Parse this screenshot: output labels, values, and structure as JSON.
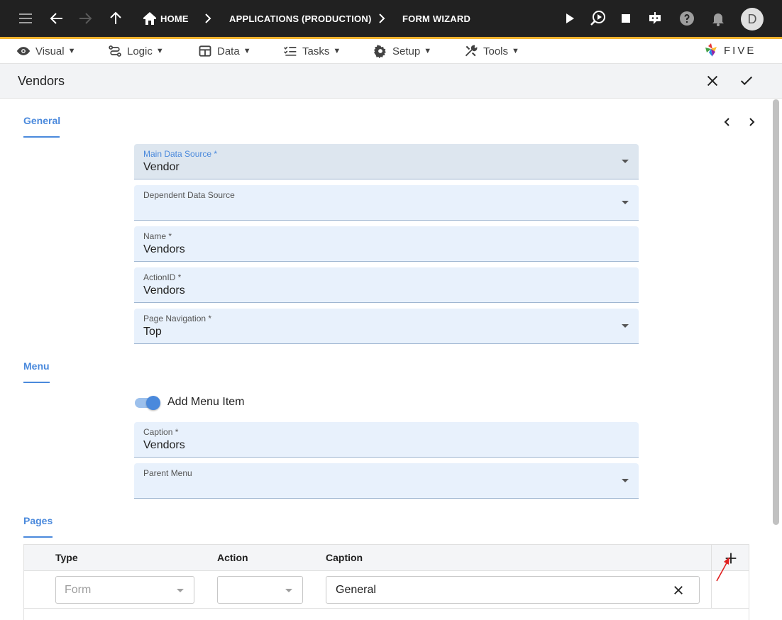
{
  "breadcrumb": {
    "home": "HOME",
    "applications": "APPLICATIONS (PRODUCTION)",
    "current": "FORM WIZARD"
  },
  "user": {
    "avatar_initial": "D"
  },
  "menu": {
    "visual": "Visual",
    "logic": "Logic",
    "data": "Data",
    "tasks": "Tasks",
    "setup": "Setup",
    "tools": "Tools"
  },
  "logo_text": "FIVE",
  "page": {
    "title": "Vendors"
  },
  "sections": {
    "general": "General",
    "menu": "Menu",
    "pages": "Pages"
  },
  "general": {
    "main_data_source": {
      "label": "Main Data Source *",
      "value": "Vendor"
    },
    "dependent_data_source": {
      "label": "Dependent Data Source",
      "value": ""
    },
    "name": {
      "label": "Name *",
      "value": "Vendors"
    },
    "action_id": {
      "label": "ActionID *",
      "value": "Vendors"
    },
    "page_navigation": {
      "label": "Page Navigation *",
      "value": "Top"
    }
  },
  "menu_section": {
    "add_menu_item": {
      "label": "Add Menu Item",
      "checked": true
    },
    "caption": {
      "label": "Caption *",
      "value": "Vendors"
    },
    "parent_menu": {
      "label": "Parent Menu",
      "value": ""
    }
  },
  "pages_table": {
    "columns": [
      "Type",
      "Action",
      "Caption"
    ],
    "rows": [
      {
        "type_placeholder": "Form",
        "action": "",
        "caption": "General"
      }
    ]
  },
  "colors": {
    "appbar": "#212121",
    "accent": "#f2b431",
    "primary": "#4a89dc",
    "field_bg": "#e8f1fc",
    "annotation_arrow": "#e02020"
  }
}
